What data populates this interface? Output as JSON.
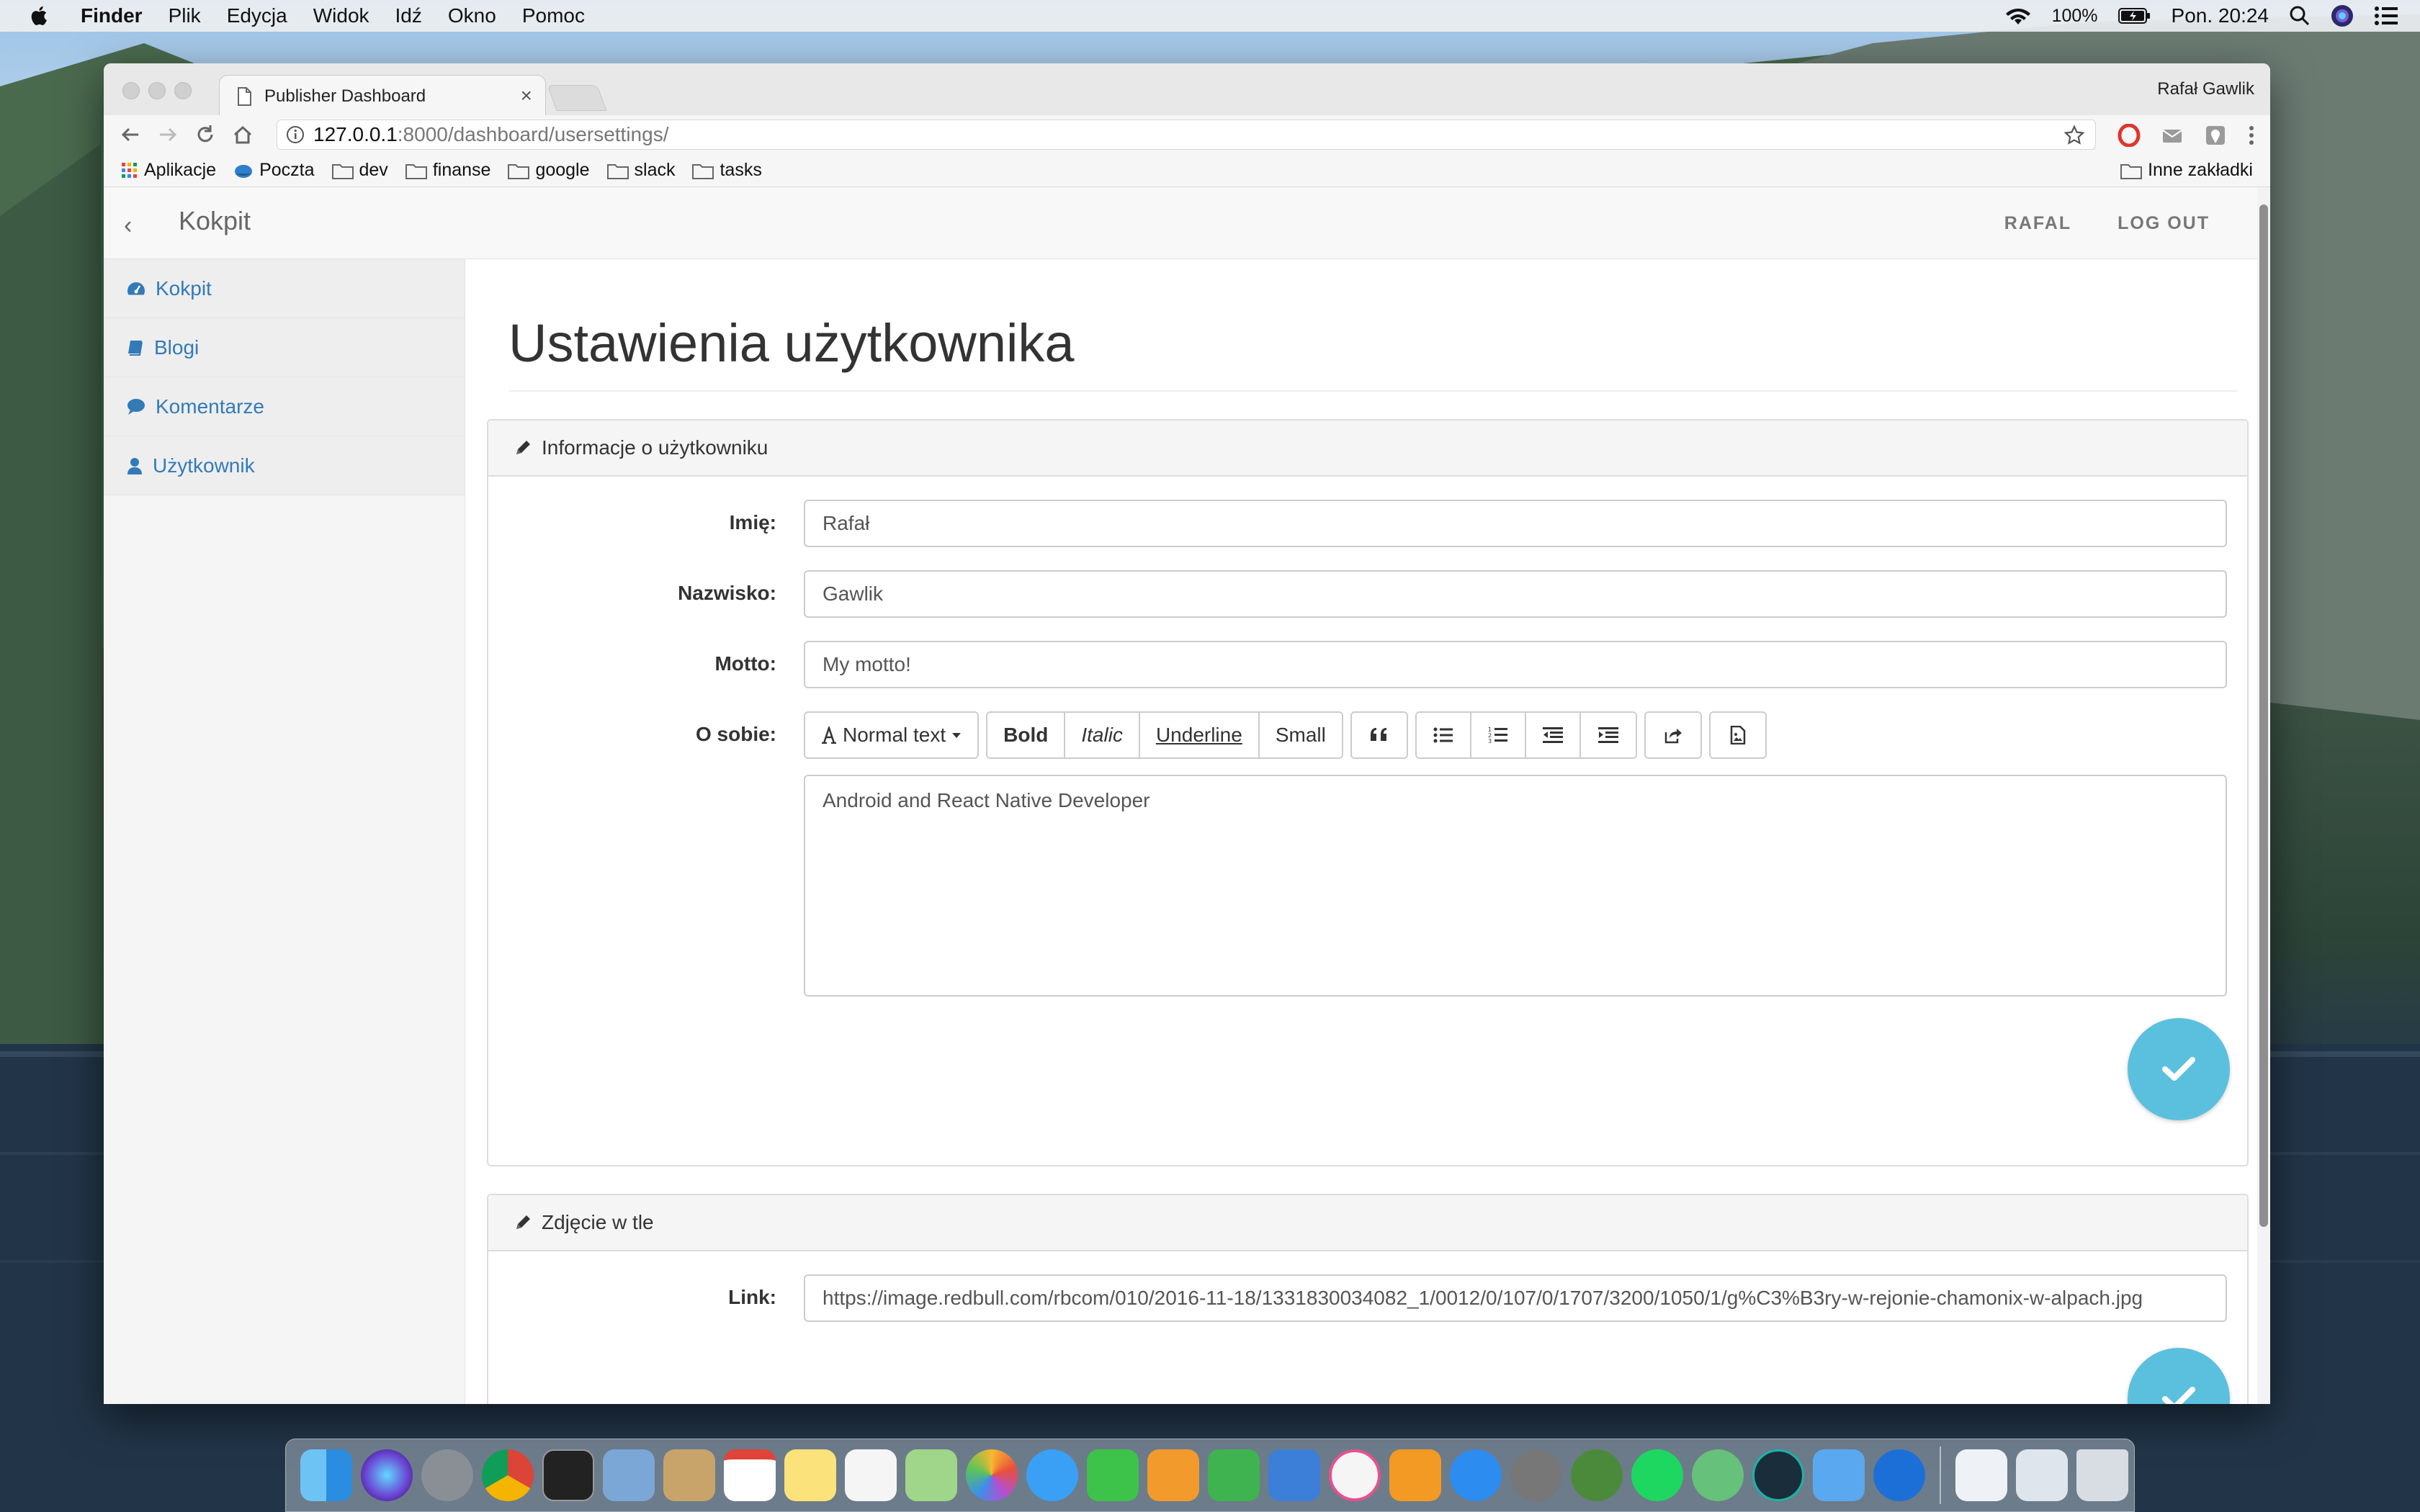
{
  "menubar": {
    "app_name": "Finder",
    "items": [
      "Plik",
      "Edycja",
      "Widok",
      "Idź",
      "Okno",
      "Pomoc"
    ],
    "battery": "100%",
    "clock": "Pon. 20:24"
  },
  "browser": {
    "tab_title": "Publisher Dashboard",
    "tab_close": "×",
    "profile_name": "Rafał Gawlik",
    "url_host": "127.0.0.1",
    "url_rest": ":8000/dashboard/usersettings/",
    "bookmarks": [
      "Aplikacje",
      "Poczta",
      "dev",
      "finanse",
      "google",
      "slack",
      "tasks"
    ],
    "other_bookmarks": "Inne zakładki"
  },
  "appbar": {
    "back_glyph": "‹",
    "brand": "Kokpit",
    "user_link": "RAFAL",
    "logout_link": "LOG OUT"
  },
  "sidebar": {
    "items": [
      {
        "label": "Kokpit",
        "icon": "dashboard-icon"
      },
      {
        "label": "Blogi",
        "icon": "book-icon"
      },
      {
        "label": "Komentarze",
        "icon": "comment-icon"
      },
      {
        "label": "Użytkownik",
        "icon": "user-icon"
      }
    ]
  },
  "main": {
    "title": "Ustawienia użytkownika",
    "user_panel": {
      "heading": "Informacje o użytkowniku",
      "fields": [
        {
          "label": "Imię:",
          "value": "Rafał"
        },
        {
          "label": "Nazwisko:",
          "value": "Gawlik"
        },
        {
          "label": "Motto:",
          "value": "My motto!"
        }
      ],
      "about_label": "O sobie:",
      "toolbar": {
        "format_label": "Normal text",
        "bold": "Bold",
        "italic": "Italic",
        "underline": "Underline",
        "small": "Small"
      },
      "about_text": "Android and React Native Developer"
    },
    "bg_panel": {
      "heading": "Zdjęcie w tle",
      "link_label": "Link:",
      "link_value": "https://image.redbull.com/rbcom/010/2016-11-18/1331830034082_1/0012/0/107/0/1707/3200/1050/1/g%C3%B3ry-w-rejonie-chamonix-w-alpach.jpg"
    }
  },
  "colors": {
    "link": "#337ab7",
    "fab": "#5bc0de"
  }
}
